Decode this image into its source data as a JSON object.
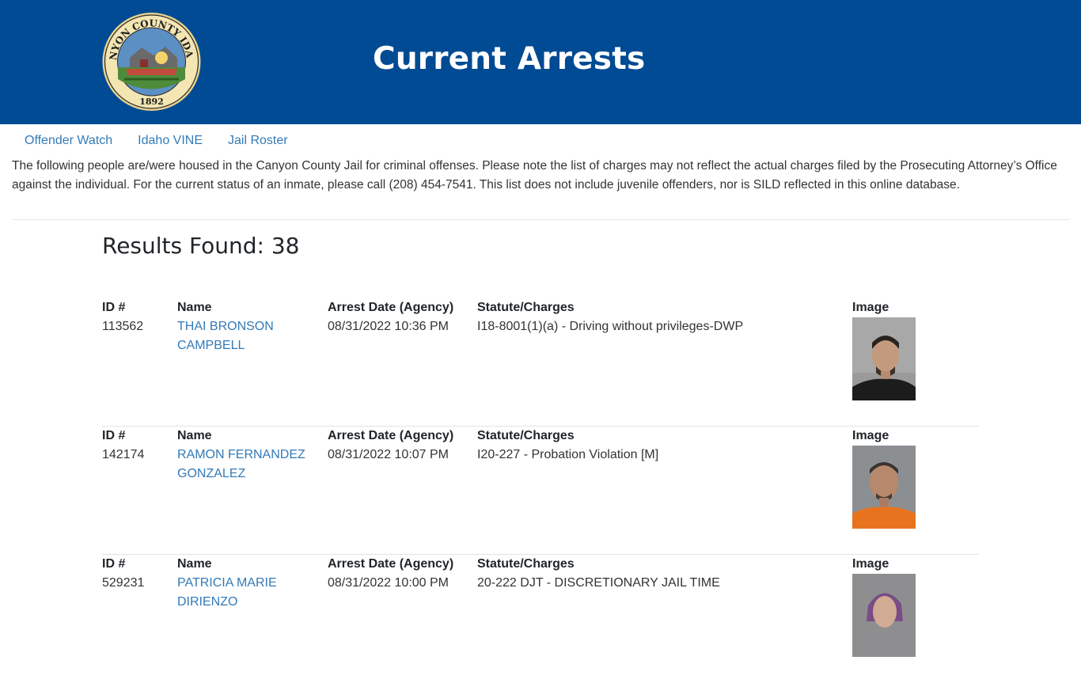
{
  "header": {
    "title": "Current Arrests",
    "seal": {
      "text_top": "CANYON COUNTY IDAHO",
      "year": "1892"
    }
  },
  "nav": [
    {
      "label": "Offender Watch"
    },
    {
      "label": "Idaho VINE"
    },
    {
      "label": "Jail Roster"
    }
  ],
  "intro": "The following people are/were housed in the Canyon County Jail for criminal offenses. Please note the list of charges may not reflect the actual charges filed by the Prosecuting Attorney’s Office against the individual. For the current status of an inmate, please call (208) 454-7541. This list does not include juvenile offenders, nor is SILD reflected in this online database.",
  "results_label": "Results Found: 38",
  "columns": {
    "id": "ID #",
    "name": "Name",
    "date": "Arrest Date (Agency)",
    "statute": "Statute/Charges",
    "image": "Image"
  },
  "records": [
    {
      "id": "113562",
      "name": "THAI BRONSON CAMPBELL",
      "date": "08/31/2022 10:36 PM",
      "statute": "I18-8001(1)(a) - Driving without privileges-DWP",
      "shirt": "#1c1c1c"
    },
    {
      "id": "142174",
      "name": "RAMON FERNANDEZ GONZALEZ",
      "date": "08/31/2022 10:07 PM",
      "statute": "I20-227 - Probation Violation [M]",
      "shirt": "#e8731f"
    },
    {
      "id": "529231",
      "name": "PATRICIA MARIE DIRIENZO",
      "date": "08/31/2022 10:00 PM",
      "statute": "20-222 DJT - DISCRETIONARY JAIL TIME",
      "shirt": "#444"
    }
  ]
}
